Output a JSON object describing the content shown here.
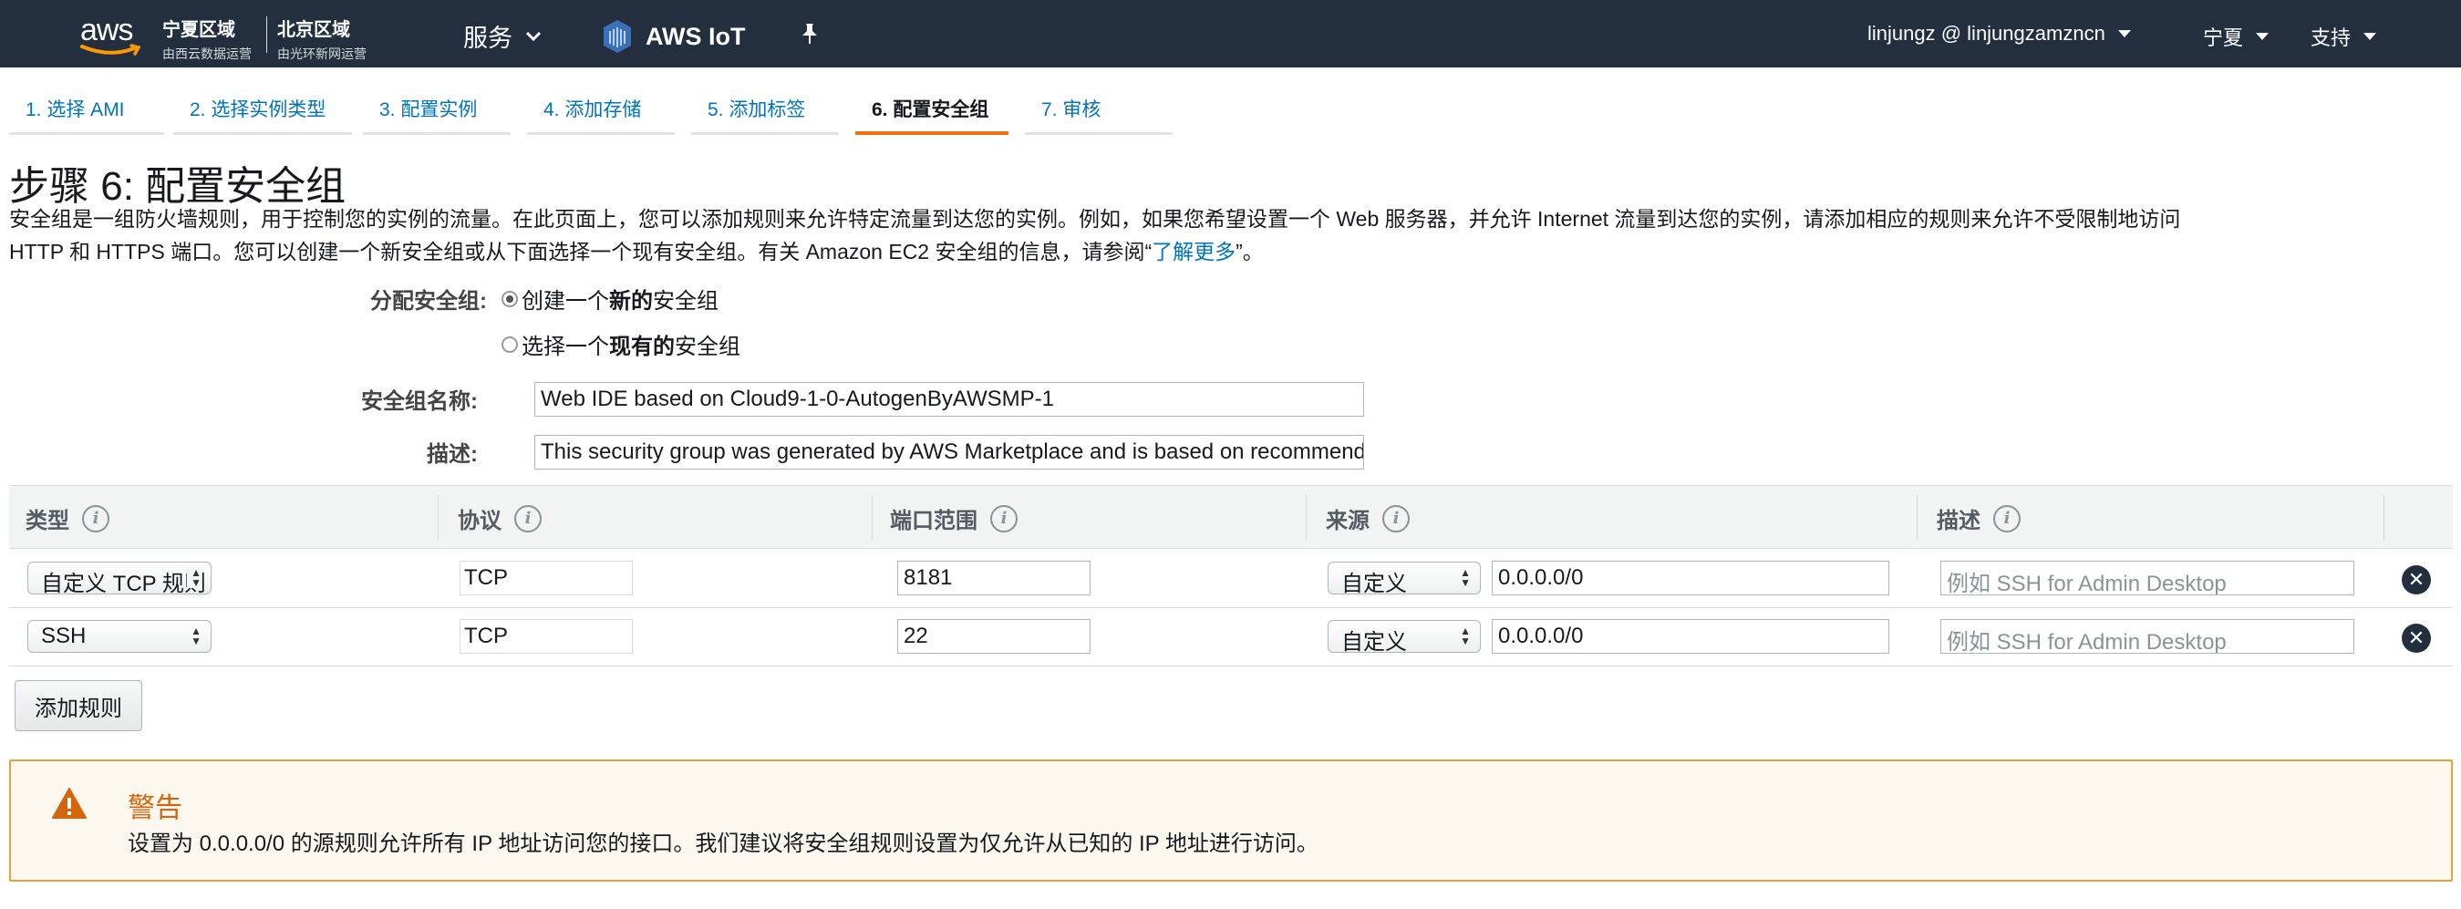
{
  "nav": {
    "logo_text": "aws",
    "region1_title": "宁夏区域",
    "region1_sub": "由西云数据运营",
    "region2_title": "北京区域",
    "region2_sub": "由光环新网运营",
    "services_label": "服务",
    "iot_label": "AWS IoT",
    "account_label": "linjungz @ linjungzamzncn",
    "region_label": "宁夏",
    "support_label": "支持"
  },
  "tabs": [
    {
      "label": "1. 选择 AMI"
    },
    {
      "label": "2. 选择实例类型"
    },
    {
      "label": "3. 配置实例"
    },
    {
      "label": "4. 添加存储"
    },
    {
      "label": "5. 添加标签"
    },
    {
      "label": "6. 配置安全组"
    },
    {
      "label": "7. 审核"
    }
  ],
  "page": {
    "title": "步骤 6: 配置安全组",
    "intro_line1": "安全组是一组防火墙规则，用于控制您的实例的流量。在此页面上，您可以添加规则来允许特定流量到达您的实例。例如，如果您希望设置一个 Web 服务器，并允许 Internet 流量到达您的实例，请添加相应的规则来允许不受限制地访问",
    "intro_line2_pre": "HTTP 和 HTTPS 端口。您可以创建一个新安全组或从下面选择一个现有安全组。有关 Amazon EC2 安全组的信息，请参阅“",
    "intro_link": "了解更多",
    "intro_line2_post": "”。"
  },
  "form": {
    "assign_label": "分配安全组:",
    "radio_new_pre": "创建一个",
    "radio_new_bold": "新的",
    "radio_new_post": "安全组",
    "radio_existing_pre": "选择一个",
    "radio_existing_bold": "现有的",
    "radio_existing_post": "安全组",
    "name_label": "安全组名称:",
    "name_value": "Web IDE based on Cloud9-1-0-AutogenByAWSMP-1",
    "desc_label": "描述:",
    "desc_value": "This security group was generated by AWS Marketplace and is based on recommended settings"
  },
  "table": {
    "headers": [
      "类型",
      "协议",
      "端口范围",
      "来源",
      "描述"
    ],
    "rows": [
      {
        "type": "自定义 TCP 规则",
        "protocol": "TCP",
        "port": "8181",
        "source_type": "自定义",
        "source_cidr": "0.0.0.0/0",
        "desc_placeholder": "例如 SSH for Admin Desktop"
      },
      {
        "type": "SSH",
        "protocol": "TCP",
        "port": "22",
        "source_type": "自定义",
        "source_cidr": "0.0.0.0/0",
        "desc_placeholder": "例如 SSH for Admin Desktop"
      }
    ]
  },
  "add_rule_label": "添加规则",
  "warning": {
    "title": "警告",
    "body": "设置为 0.0.0.0/0 的源规则允许所有 IP 地址访问您的接口。我们建议将安全组规则设置为仅允许从已知的 IP 地址进行访问。"
  }
}
